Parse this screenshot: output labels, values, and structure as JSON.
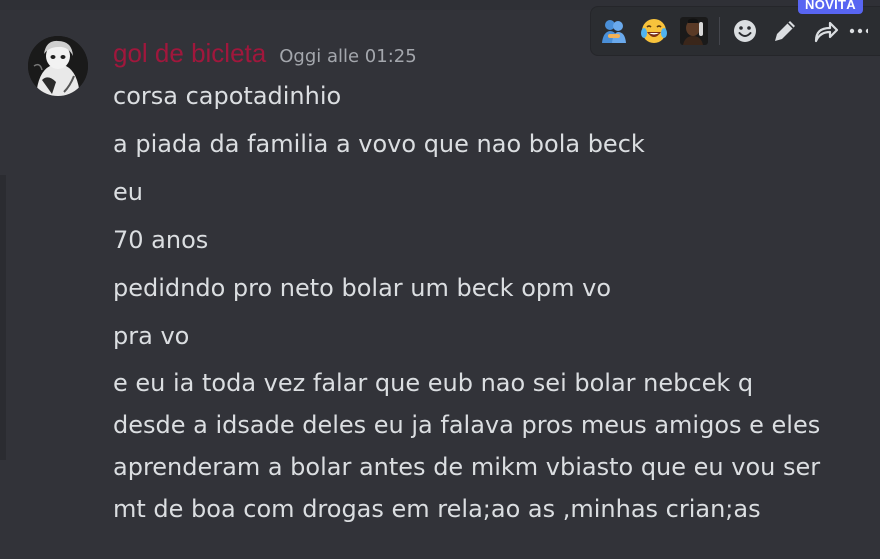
{
  "toolbar": {
    "new_badge": "NOVITÀ",
    "reactions": [
      {
        "icon": "people-hugging-emoji-icon"
      },
      {
        "icon": "laughing-crying-emoji-icon"
      },
      {
        "icon": "custom-emoji-icon"
      }
    ],
    "actions": [
      {
        "icon": "add-reaction-icon"
      },
      {
        "icon": "edit-pencil-icon"
      },
      {
        "icon": "reply-arrow-icon"
      },
      {
        "icon": "more-options-icon"
      }
    ]
  },
  "message": {
    "username": "gol de bicleta",
    "timestamp": "Oggi alle 01:25",
    "lines": [
      "corsa capotadinhio",
      "a piada da familia a vovo que nao bola beck",
      "eu",
      "70 anos",
      "pedidndo pro neto bolar um beck opm vo",
      "pra vo",
      "e eu ia toda vez falar que eub nao sei bolar nebcek q\ndesde a idsade deles eu ja falava pros meus amigos e eles\naprenderam a bolar antes de mikm vbiasto que eu vou ser\nmt de boa com drogas em rela;ao as ,minhas crian;as"
    ]
  },
  "colors": {
    "background": "#323339",
    "username": "#a0173c",
    "text": "#dbdee1",
    "timestamp": "#a4a7ad",
    "badge": "#5865f2"
  }
}
